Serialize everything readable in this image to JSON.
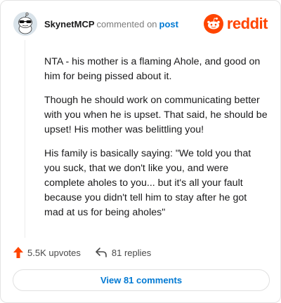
{
  "header": {
    "username": "SkynetMCP",
    "action_text": "commented on",
    "post_link": "post",
    "brand": "reddit",
    "avatar_icon": "snoo-sunglasses-avatar-icon",
    "brand_icon": "reddit-alien-logo-icon"
  },
  "comment": {
    "paragraphs": [
      "NTA - his mother is a flaming Ahole, and good on him for being pissed about it.",
      "Though he should work on communicating better with you when he is upset. That said, he should be upset! His mother was belittling you!",
      "His family is basically saying: \"We told you that you suck, that we don't like you, and were complete aholes to you... but it's all your fault because you didn't tell him to stay after he got mad at us for being aholes\""
    ]
  },
  "actions": {
    "upvotes": "5.5K upvotes",
    "replies": "81 replies",
    "upvote_icon": "upvote-arrow-icon",
    "reply_icon": "reply-arrow-icon"
  },
  "footer": {
    "view_label": "View 81 comments"
  },
  "colors": {
    "brand": "#ff4500",
    "link": "#0079d3",
    "muted": "#7c7c7c"
  }
}
